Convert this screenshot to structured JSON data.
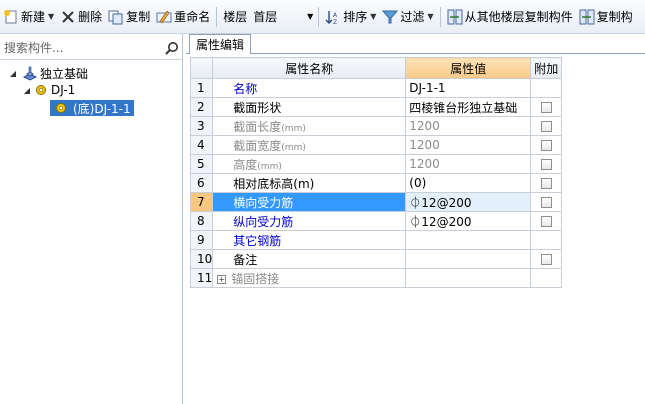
{
  "toolbar": {
    "new_label": "新建",
    "delete_label": "删除",
    "copy_label": "复制",
    "rename_label": "重命名",
    "floor_label": "楼层",
    "floor_value": "首层",
    "sort_label": "排序",
    "filter_label": "过滤",
    "copy_from_floor_label": "从其他楼层复制构件",
    "copy_to_label": "复制构"
  },
  "search": {
    "placeholder": "搜索构件..."
  },
  "tree": {
    "root_label": "独立基础",
    "child_label": "DJ-1",
    "leaf_label": "(底)DJ-1-1"
  },
  "tab": {
    "label": "属性编辑"
  },
  "grid": {
    "headers": {
      "name": "属性名称",
      "value": "属性值",
      "extra": "附加"
    },
    "rows": [
      {
        "num": "1",
        "name": "名称",
        "value": "DJ-1-1"
      },
      {
        "num": "2",
        "name": "截面形状",
        "value": "四棱锥台形独立基础"
      },
      {
        "num": "3",
        "name": "截面长度",
        "unit": "(mm)",
        "value": "1200"
      },
      {
        "num": "4",
        "name": "截面宽度",
        "unit": "(mm)",
        "value": "1200"
      },
      {
        "num": "5",
        "name": "高度",
        "unit": "(mm)",
        "value": "1200"
      },
      {
        "num": "6",
        "name": "相对底标高(m)",
        "value": "(0)"
      },
      {
        "num": "7",
        "name": "横向受力筋",
        "value": "12@200"
      },
      {
        "num": "8",
        "name": "纵向受力筋",
        "value": "12@200"
      },
      {
        "num": "9",
        "name": "其它钢筋",
        "value": ""
      },
      {
        "num": "10",
        "name": "备注",
        "value": ""
      },
      {
        "num": "11",
        "name": "锚固搭接",
        "value": ""
      }
    ]
  }
}
